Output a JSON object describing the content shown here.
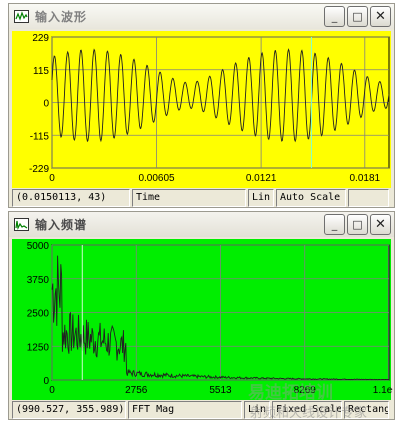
{
  "colors": {
    "wave_bg": "#ffff00",
    "spectrum_bg": "#00ee00",
    "cursor": "#7fffd4",
    "grid": "#808080"
  },
  "waveform_window": {
    "title": "输入波形",
    "icon": "waveform-icon",
    "y_ticks": [
      "229",
      "115",
      "0",
      "-115",
      "-229"
    ],
    "x_ticks": [
      "0",
      "0.00605",
      "0.0121",
      "0.0181"
    ],
    "status": {
      "cursor": "(0.0150113, 43)",
      "field": "Time",
      "scale": "Lin",
      "mode": "Auto Scale"
    }
  },
  "spectrum_window": {
    "title": "输入频谱",
    "icon": "spectrum-icon",
    "y_ticks": [
      "5000",
      "3750",
      "2500",
      "1250",
      "0"
    ],
    "x_ticks": [
      "0",
      "2756",
      "5513",
      "8269",
      "1.1e+4"
    ],
    "status": {
      "cursor": "(990.527, 355.989)",
      "field": "FFT Mag",
      "scale": "Lin",
      "mode": "Fixed Scale",
      "window": "Rectangu"
    }
  },
  "chart_data": [
    {
      "type": "line",
      "xlabel": "",
      "ylabel": "",
      "xlim": [
        0,
        0.0195
      ],
      "ylim": [
        -229,
        229
      ],
      "grid": true,
      "cursor_x": 0.0150113,
      "series": [
        {
          "description_free": true,
          "x": [
            0,
            0.0195
          ],
          "y": [
            115,
            115
          ]
        }
      ]
    },
    {
      "type": "line",
      "xlabel": "",
      "ylabel": "",
      "xlim": [
        0,
        11025
      ],
      "ylim": [
        0,
        5000
      ],
      "grid": true,
      "cursor_x": 990.527,
      "series": [
        {
          "description_free": true,
          "x": [
            0,
            11025
          ],
          "y": [
            0,
            0
          ]
        }
      ]
    }
  ],
  "watermark": {
    "line1": "易迪拓培训",
    "line2": "射频和天线设计专家"
  }
}
